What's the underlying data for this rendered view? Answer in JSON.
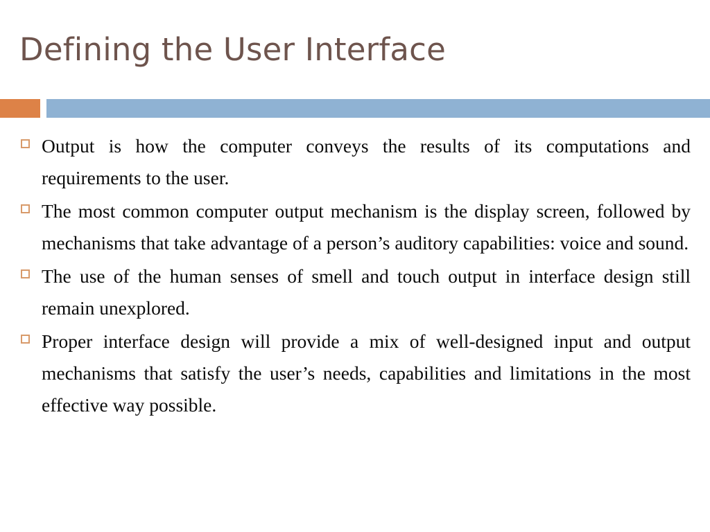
{
  "slide": {
    "title": "Defining the User Interface",
    "title_color": "#6E544D",
    "accent_color": "#DD8247",
    "bar_color": "#8FB2D3",
    "bullet_marker_color": "#D89A6A",
    "background_color": "#FFFFFF",
    "body_text_color": "#0B0B0B"
  },
  "body": {
    "bullets": [
      {
        "marker": "hollow-square-bullet",
        "text": "Output is how the computer conveys the results of its computations and requirements to the user."
      },
      {
        "marker": "hollow-square-bullet",
        "text": "The most common computer output mechanism is the display screen, followed by mechanisms that take advantage of a person’s auditory capabilities: voice and sound."
      },
      {
        "marker": "hollow-square-bullet",
        "text": "The use of the human senses of smell and touch output in interface design still remain unexplored."
      },
      {
        "marker": "hollow-square-bullet",
        "text": "Proper interface design will provide a mix of well-designed input and output mechanisms that satisfy the user’s needs, capabilities and limitations in the most effective way possible."
      }
    ]
  }
}
